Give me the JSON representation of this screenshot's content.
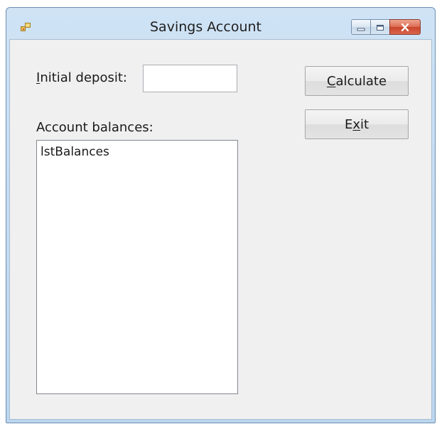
{
  "window": {
    "title": "Savings Account"
  },
  "form": {
    "initial_deposit_label": {
      "mnemonic": "I",
      "rest": "nitial deposit:"
    },
    "initial_deposit_value": "",
    "account_balances_label": "Account balances:",
    "list_items": [
      "lstBalances"
    ]
  },
  "buttons": {
    "calculate": {
      "mnemonic": "C",
      "rest": "alculate"
    },
    "exit": {
      "before": "E",
      "mnemonic": "x",
      "after": "it"
    }
  },
  "colors": {
    "frame": "#cfe3f5",
    "client": "#f0f0f0",
    "close_button": "#c9452b"
  }
}
